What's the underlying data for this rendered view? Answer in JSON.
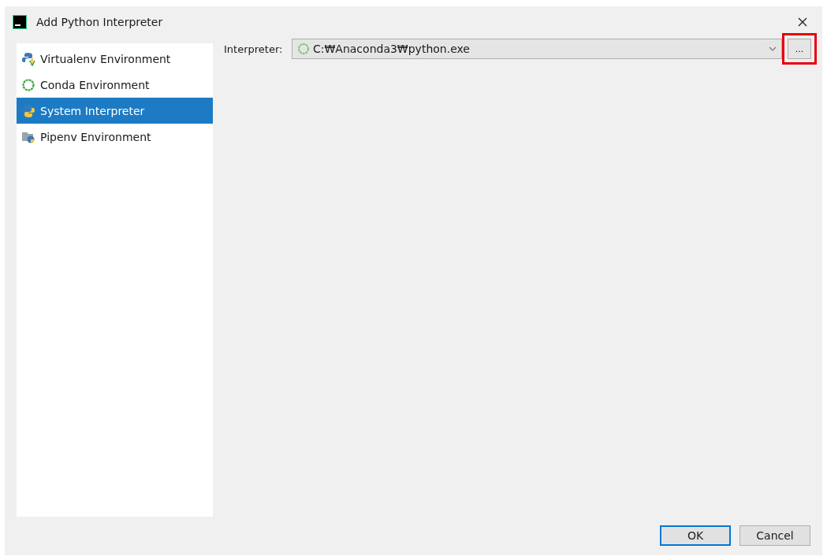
{
  "window": {
    "title": "Add Python Interpreter"
  },
  "sidebar": {
    "items": [
      {
        "label": "Virtualenv Environment",
        "kind": "virtualenv",
        "selected": false
      },
      {
        "label": "Conda Environment",
        "kind": "conda",
        "selected": false
      },
      {
        "label": "System Interpreter",
        "kind": "system",
        "selected": true
      },
      {
        "label": "Pipenv Environment",
        "kind": "pipenv",
        "selected": false
      }
    ]
  },
  "interpreter": {
    "label": "Interpreter:",
    "value": "C:₩Anaconda3₩python.exe",
    "browse": {
      "label": "...",
      "highlighted": true
    }
  },
  "buttons": [
    {
      "label": "OK",
      "default": true
    },
    {
      "label": "Cancel",
      "default": false
    }
  ]
}
